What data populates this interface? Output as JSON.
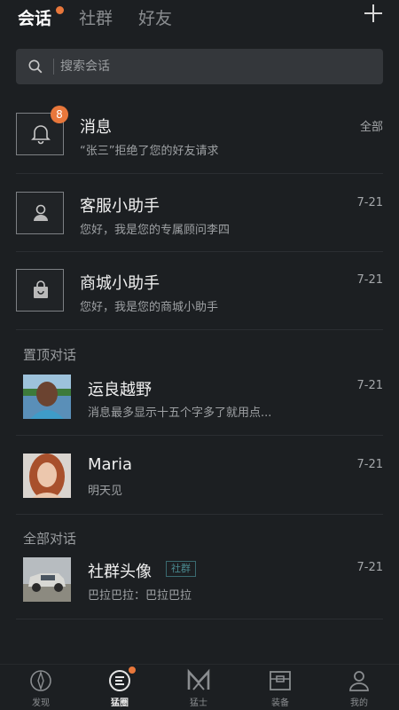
{
  "tabs": [
    {
      "label": "会话"
    },
    {
      "label": "社群"
    },
    {
      "label": "好友"
    }
  ],
  "search": {
    "placeholder": "搜索会话"
  },
  "system_items": [
    {
      "title": "消息",
      "subtitle": "“张三”拒绝了您的好友请求",
      "time": "全部",
      "badge": "8",
      "icon": "bell-icon"
    },
    {
      "title": "客服小助手",
      "subtitle": "您好，我是您的专属顾问李四",
      "time": "7-21",
      "icon": "user-icon"
    },
    {
      "title": "商城小助手",
      "subtitle": "您好，我是您的商城小助手",
      "time": "7-21",
      "icon": "shopping-bag-icon"
    }
  ],
  "pinned_section_label": "置顶对话",
  "pinned_chats": [
    {
      "name": "运良越野",
      "message": "消息最多显示十五个字多了就用点...",
      "time": "7-21"
    },
    {
      "name": "Maria",
      "message": "明天见",
      "time": "7-21"
    }
  ],
  "all_section_label": "全部对话",
  "all_chats": [
    {
      "name": "社群头像",
      "tag": "社群",
      "message": "巴拉巴拉：巴拉巴拉",
      "time": "7-21"
    }
  ],
  "bottom_nav": [
    {
      "label": "发现",
      "icon": "compass-icon"
    },
    {
      "label": "猛圈",
      "icon": "circle-chat-icon"
    },
    {
      "label": "猛士",
      "icon": "brand-m-icon"
    },
    {
      "label": "装备",
      "icon": "gear-box-icon"
    },
    {
      "label": "我的",
      "icon": "profile-icon"
    }
  ],
  "colors": {
    "accent": "#e8773b",
    "background": "#1c1f22"
  }
}
